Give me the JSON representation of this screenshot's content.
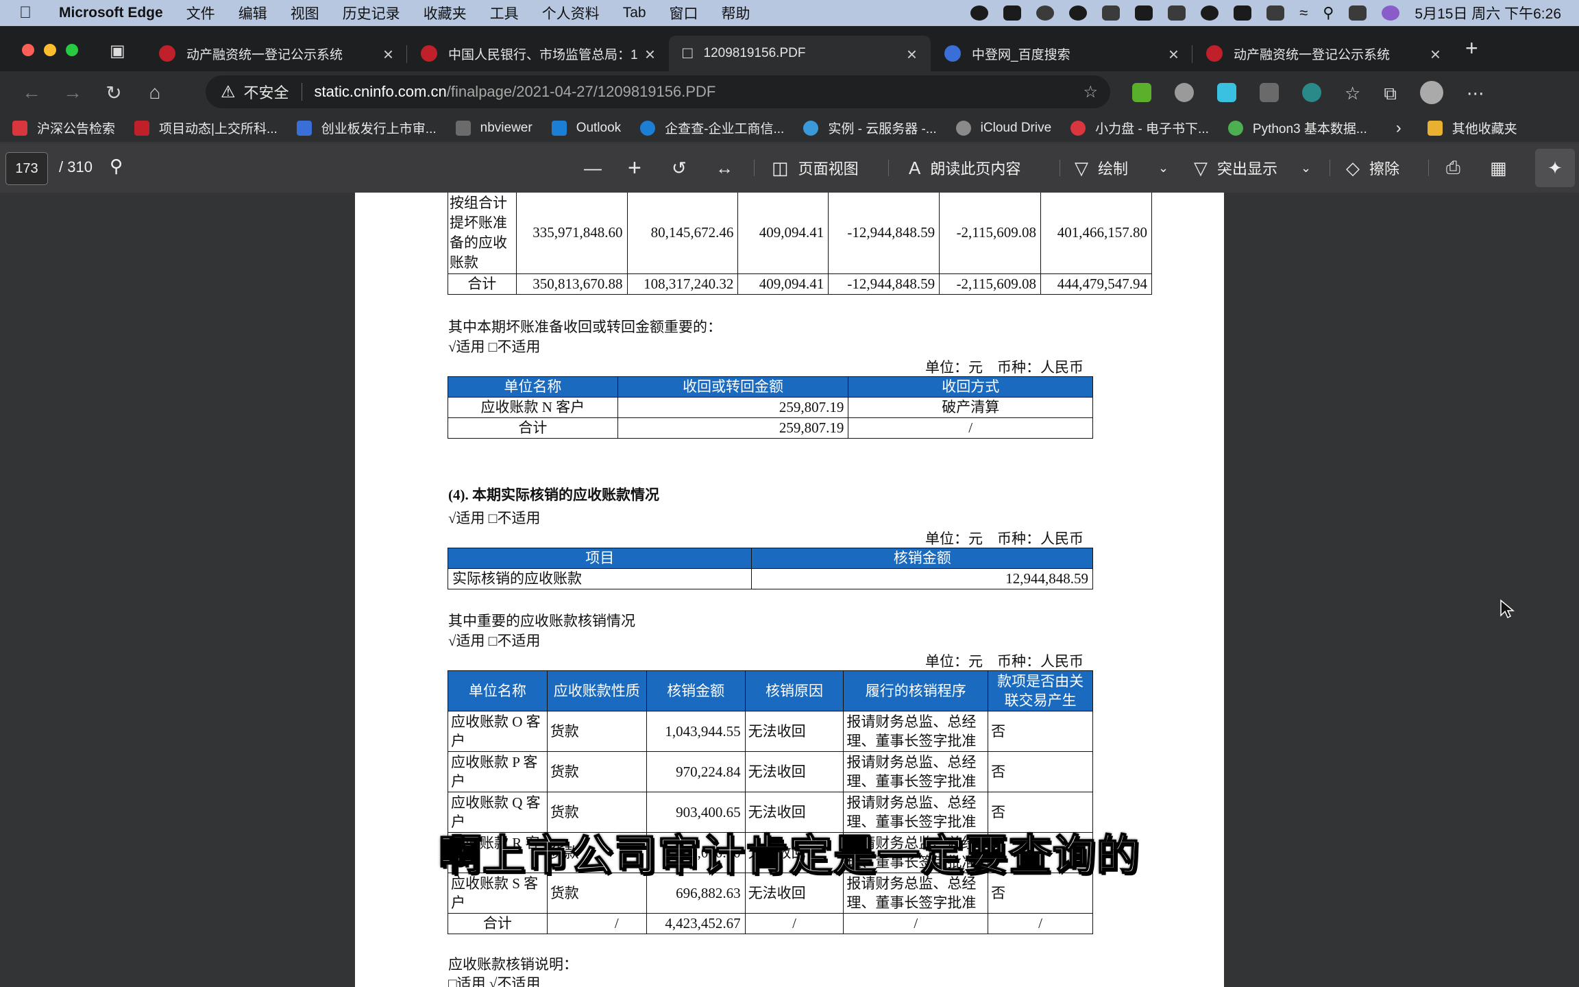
{
  "menubar": {
    "app": "Microsoft Edge",
    "items": [
      "文件",
      "编辑",
      "视图",
      "历史记录",
      "收藏夹",
      "工具",
      "个人资料",
      "Tab",
      "窗口",
      "帮助"
    ],
    "datetime": "5月15日 周六 下午6:26"
  },
  "tabs": [
    {
      "title": "动产融资统一登记公示系统",
      "color": "#c0202a"
    },
    {
      "title": "中国人民银行、市场监管总局：1",
      "color": "#c0202a"
    },
    {
      "title": "1209819156.PDF",
      "color": "#dddddd"
    },
    {
      "title": "中登网_百度搜索",
      "color": "#3a6fd8"
    },
    {
      "title": "动产融资统一登记公示系统",
      "color": "#c0202a"
    }
  ],
  "address": {
    "warning": "不安全",
    "host": "static.cninfo.com.cn",
    "path": "/finalpage/2021-04-27/1209819156.PDF"
  },
  "bookmarks": [
    {
      "label": "沪深公告检索",
      "color": "#d9363e"
    },
    {
      "label": "项目动态|上交所科...",
      "color": "#c0202a"
    },
    {
      "label": "创业板发行上市审...",
      "color": "#3a6fd8"
    },
    {
      "label": "nbviewer",
      "color": "#6b6b6b"
    },
    {
      "label": "Outlook",
      "color": "#1c7fd6"
    },
    {
      "label": "企查查-企业工商信...",
      "color": "#1c7fd6"
    },
    {
      "label": "实例 - 云服务器 -...",
      "color": "#3a9ad9"
    },
    {
      "label": "iCloud Drive",
      "color": "#8a8a8a"
    },
    {
      "label": "小力盘 - 电子书下...",
      "color": "#d9363e"
    },
    {
      "label": "Python3 基本数据...",
      "color": "#4caf50"
    }
  ],
  "bookmarks_other": "其他收藏夹",
  "pdf_toolbar": {
    "page": "173",
    "total": "/ 310",
    "page_view": "页面视图",
    "read_aloud": "朗读此页内容",
    "draw": "绘制",
    "highlight": "突出显示",
    "erase": "擦除"
  },
  "doc": {
    "table1": {
      "rows": [
        {
          "label": "按组合计提坏账准备的应收账款",
          "c1": "335,971,848.60",
          "c2": "80,145,672.46",
          "c3": "409,094.41",
          "c4": "-12,944,848.59",
          "c5": "-2,115,609.08",
          "c6": "401,466,157.80"
        },
        {
          "label": "合计",
          "c1": "350,813,670.88",
          "c2": "108,317,240.32",
          "c3": "409,094.41",
          "c4": "-12,944,848.59",
          "c5": "-2,115,609.08",
          "c6": "444,479,547.94"
        }
      ]
    },
    "recovery_heading": "其中本期坏账准备收回或转回金额重要的：",
    "applicable": "√适用 □不适用",
    "not_applicable": "□适用 √不适用",
    "unit": "单位：元　币种：人民币",
    "table2": {
      "headers": [
        "单位名称",
        "收回或转回金额",
        "收回方式"
      ],
      "rows": [
        [
          "应收账款 N 客户",
          "259,807.19",
          "破产清算"
        ],
        [
          "合计",
          "259,807.19",
          "/"
        ]
      ]
    },
    "section4": "(4). 本期实际核销的应收账款情况",
    "table3": {
      "headers": [
        "项目",
        "核销金额"
      ],
      "rows": [
        [
          "实际核销的应收账款",
          "12,944,848.59"
        ]
      ]
    },
    "important_heading": "其中重要的应收账款核销情况",
    "table4": {
      "headers": [
        "单位名称",
        "应收账款性质",
        "核销金额",
        "核销原因",
        "履行的核销程序",
        "款项是否由关联交易产生"
      ],
      "rows": [
        [
          "应收账款 O 客户",
          "货款",
          "1,043,944.55",
          "无法收回",
          "报请财务总监、总经理、董事长签字批准",
          "否"
        ],
        [
          "应收账款 P 客户",
          "货款",
          "970,224.84",
          "无法收回",
          "报请财务总监、总经理、董事长签字批准",
          "否"
        ],
        [
          "应收账款 Q 客户",
          "货款",
          "903,400.65",
          "无法收回",
          "报请财务总监、总经理、董事长签字批准",
          "否"
        ],
        [
          "应收账款 R 客户",
          "货款",
          "809,000.00",
          "无法收回",
          "报请财务总监、总经理、董事长签字批准",
          "否"
        ],
        [
          "应收账款 S 客户",
          "货款",
          "696,882.63",
          "无法收回",
          "报请财务总监、总经理、董事长签字批准",
          "否"
        ]
      ],
      "total": [
        "合计",
        "/",
        "4,423,452.67",
        "/",
        "/",
        "/"
      ]
    },
    "writeoff_note": "应收账款核销说明："
  },
  "subtitle": "啊上市公司审计肯定是一定要查询的"
}
